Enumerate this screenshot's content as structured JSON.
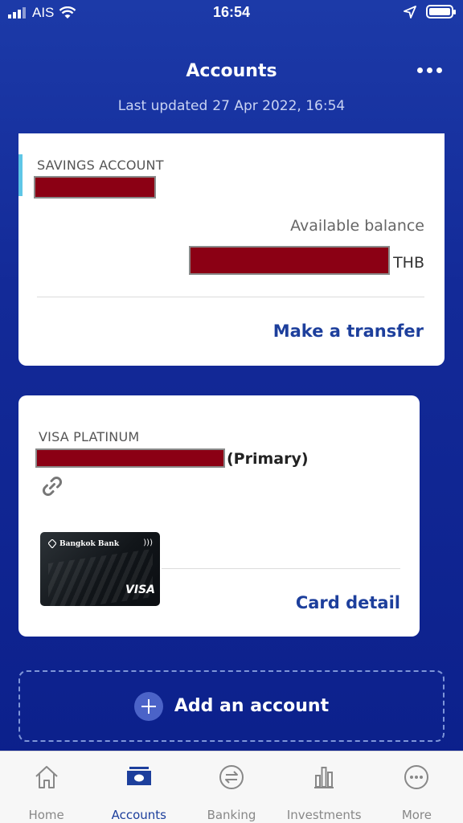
{
  "status_bar": {
    "carrier": "AIS",
    "time": "16:54",
    "icons": [
      "signal-icon",
      "wifi-icon",
      "location-arrow-icon",
      "battery-icon"
    ]
  },
  "header": {
    "title": "Accounts",
    "last_updated_label": "Last updated",
    "last_updated_value": "27 Apr 2022, 16:54"
  },
  "savings_card": {
    "type": "SAVINGS ACCOUNT",
    "available_balance_label": "Available balance",
    "currency": "THB",
    "action": "Make a transfer"
  },
  "visa_card": {
    "type": "VISA PLATINUM",
    "primary_label": "(Primary)",
    "card_image": {
      "bank": "Bangkok Bank",
      "network": "VISA"
    },
    "action": "Card detail"
  },
  "add_account": {
    "label": "Add an account"
  },
  "tabs": [
    {
      "label": "Home",
      "icon": "home-icon",
      "active": false
    },
    {
      "label": "Accounts",
      "icon": "wallet-icon",
      "active": true
    },
    {
      "label": "Banking",
      "icon": "transfer-icon",
      "active": false
    },
    {
      "label": "Investments",
      "icon": "bar-chart-icon",
      "active": false
    },
    {
      "label": "More",
      "icon": "more-icon",
      "active": false
    }
  ],
  "colors": {
    "accent": "#1d3f9c",
    "background": "#132a98",
    "redaction": "#8b0014",
    "savings_accent": "#5ec6e6"
  }
}
